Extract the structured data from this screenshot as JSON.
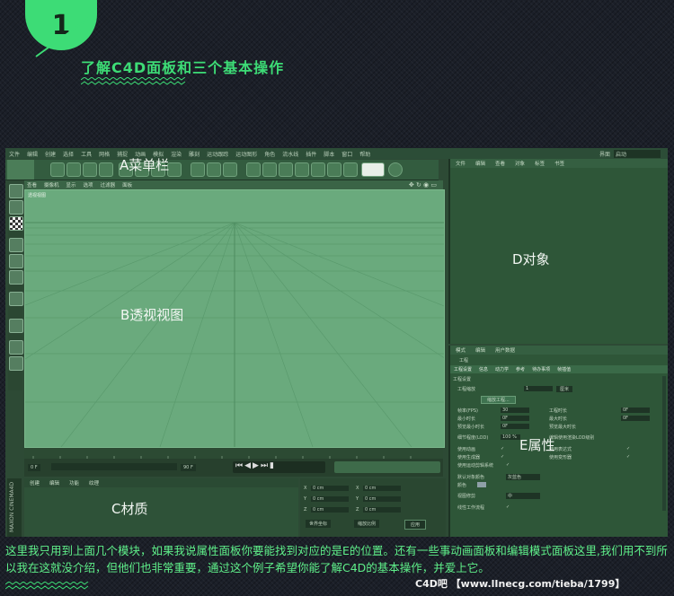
{
  "header": {
    "step_number": "1",
    "headline": "了解C4D面板和三个基本操作"
  },
  "screenshot": {
    "menu": [
      "文件",
      "编辑",
      "创建",
      "选择",
      "工具",
      "网格",
      "捕捉",
      "动画",
      "模拟",
      "渲染",
      "雕刻",
      "运动跟踪",
      "运动图形",
      "角色",
      "流水线",
      "插件",
      "脚本",
      "窗口",
      "帮助"
    ],
    "interface_label": "界面",
    "interface_value": "启动",
    "viewport_tabs": [
      "查看",
      "摄像机",
      "显示",
      "选项",
      "过滤器",
      "面板"
    ],
    "viewport_name": "透视视图",
    "object_tabs": [
      "文件",
      "编辑",
      "查看",
      "对象",
      "标签",
      "书签"
    ],
    "attr_tabs": [
      "模式",
      "编辑",
      "用户数据"
    ],
    "attr_title": "工程",
    "attr_subtabs": [
      "工程设置",
      "信息",
      "动力学",
      "参考",
      "待办事项",
      "帧插值"
    ],
    "attr_section": "工程设置",
    "attr_rows": [
      {
        "k": "工程缩放",
        "v": "1",
        "u": "厘米"
      },
      {
        "k": "缩放工程...",
        "v": "",
        "u": ""
      },
      {
        "k": "帧率(FPS)",
        "v": "30",
        "u": "工程时长"
      },
      {
        "k": "最小时长",
        "v": "0F",
        "u": "最大时长"
      },
      {
        "k": "预览最小时长",
        "v": "0F",
        "u": "预览最大时长"
      },
      {
        "k": "细节程度(LOD)",
        "v": "100 %",
        "u": "编辑使用渲染LOD级别"
      },
      {
        "k": "使用动画",
        "v": "✓",
        "u": "使用表达式"
      },
      {
        "k": "使用生成器",
        "v": "✓",
        "u": "使用变形器"
      },
      {
        "k": "使用运动剪辑系统",
        "v": "✓",
        "u": ""
      },
      {
        "k": "默认对象颜色",
        "v": "灰蓝色",
        "u": ""
      },
      {
        "k": "颜色",
        "v": "",
        "u": ""
      },
      {
        "k": "视图修剪",
        "v": "中",
        "u": ""
      },
      {
        "k": "线性工作流程",
        "v": "✓",
        "u": ""
      }
    ],
    "mat_tabs": [
      "创建",
      "编辑",
      "功能",
      "纹理"
    ],
    "frame_start": "0 F",
    "frame_end": "90 F",
    "coords_labels": [
      "X",
      "Y",
      "Z"
    ],
    "coord_value": "0 cm",
    "coord_buttons": [
      "世界坐标",
      "缩放比例",
      "应用"
    ],
    "maxon_label": "MAXON CINEMA4D",
    "labels": {
      "menu": "A菜单栏",
      "viewport": "B透视视图",
      "material": "C材质",
      "object": "D对象",
      "attribute": "E属性"
    }
  },
  "caption": "这里我只用到上面几个模块，如果我说属性面板你要能找到对应的是E的位置。还有一些事动画面板和编辑模式面板这里,我们用不到所以我在这就没介绍，但他们也非常重要，通过这个例子希望你能了解C4D的基本操作，并爱上它。",
  "credit": "C4D吧 【www.lInecg.com/tieba/1799】",
  "colors": {
    "accent": "#3ddc76",
    "panel": "#2e5638",
    "viewport": "#6aaa7d"
  }
}
